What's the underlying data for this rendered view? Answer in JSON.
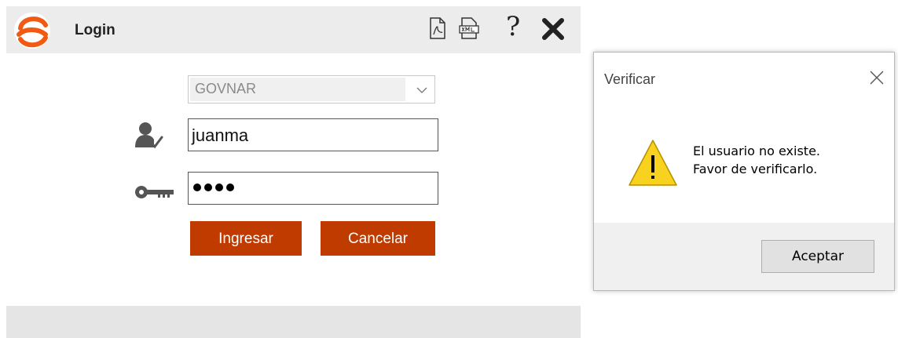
{
  "login": {
    "title": "Login",
    "organization": {
      "selected": "GOVNAR"
    },
    "username": {
      "value": "juanma"
    },
    "password": {
      "masked_length": 4
    },
    "ingresar_label": "Ingresar",
    "cancelar_label": "Cancelar",
    "toolbar_icons": [
      "pdf-icon",
      "xml-icon",
      "help-icon",
      "close-icon"
    ],
    "help_label": "?"
  },
  "dialog": {
    "title": "Verificar",
    "message_line1": "El usuario no existe.",
    "message_line2": "Favor de verificarlo.",
    "accept_label": "Aceptar"
  },
  "colors": {
    "accent": "#c03b00",
    "logo": "#f05a12",
    "warning": "#f8d21e"
  }
}
